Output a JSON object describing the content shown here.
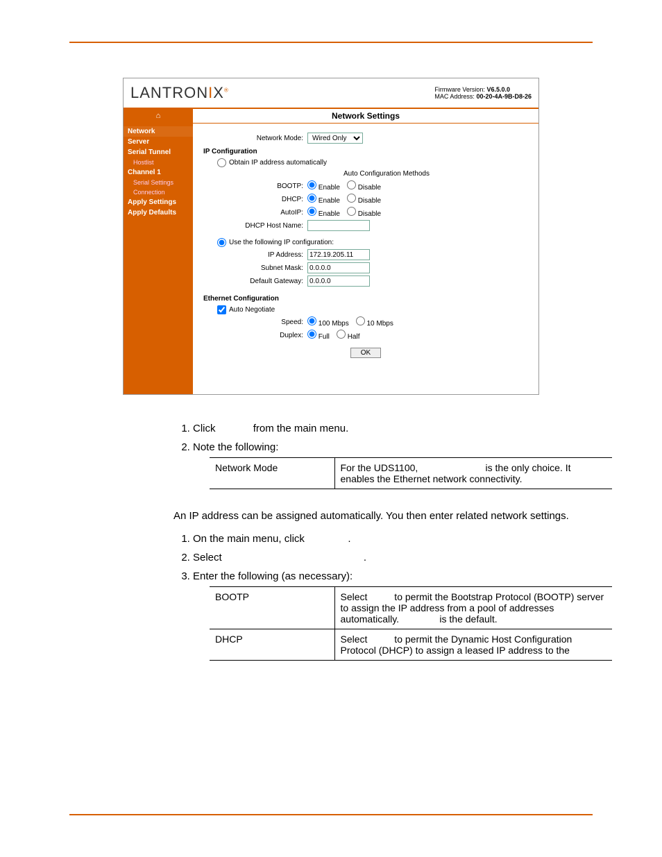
{
  "header_meta": {
    "fw_label": "Firmware Version:",
    "fw_value": "V6.5.0.0",
    "mac_label": "MAC Address:",
    "mac_value": "00-20-4A-9B-D8-26"
  },
  "logo": {
    "part1": "LANTRON",
    "part2": "I",
    "part3": "X",
    "reg": "®"
  },
  "page_title": "Network Settings",
  "sidebar": [
    {
      "label": "Network",
      "cls": "group current"
    },
    {
      "label": "Server",
      "cls": "group"
    },
    {
      "label": "Serial Tunnel",
      "cls": "group"
    },
    {
      "label": "Hostlist",
      "cls": "child"
    },
    {
      "label": "Channel 1",
      "cls": "group"
    },
    {
      "label": "Serial Settings",
      "cls": "child"
    },
    {
      "label": "Connection",
      "cls": "child"
    },
    {
      "label": "Apply Settings",
      "cls": "group"
    },
    {
      "label": "Apply Defaults",
      "cls": "group"
    }
  ],
  "form": {
    "network_mode_label": "Network Mode:",
    "network_mode_value": "Wired Only",
    "ip_config_h": "IP Configuration",
    "obtain_auto": "Obtain IP address automatically",
    "auto_methods": "Auto Configuration Methods",
    "bootp_label": "BOOTP:",
    "dhcp_label": "DHCP:",
    "autoip_label": "AutoIP:",
    "enable": "Enable",
    "disable": "Disable",
    "dhcp_host_label": "DHCP Host Name:",
    "use_following": "Use the following IP configuration:",
    "ip_addr_label": "IP Address:",
    "ip_addr_value": "172.19.205.11",
    "subnet_label": "Subnet Mask:",
    "subnet_value": "0.0.0.0",
    "gateway_label": "Default Gateway:",
    "gateway_value": "0.0.0.0",
    "eth_h": "Ethernet Configuration",
    "auto_negotiate": "Auto Negotiate",
    "speed_label": "Speed:",
    "speed_100": "100 Mbps",
    "speed_10": "10 Mbps",
    "duplex_label": "Duplex:",
    "full": "Full",
    "half": "Half",
    "ok": "OK"
  },
  "doc": {
    "step1": "Click",
    "step1_tail": "from the main menu.",
    "step2": "Note the following:",
    "t1c1": "Network Mode",
    "t1c2a": "For the UDS1100,",
    "t1c2b": "is the only choice. It enables the Ethernet network connectivity.",
    "para1": "An IP address can be assigned automatically. You then enter related network settings.",
    "s2_1a": "On the main menu, click",
    "s2_1b": ".",
    "s2_2a": "Select",
    "s2_2b": ".",
    "s2_3": "Enter the following (as necessary):",
    "t2r1c1": "BOOTP",
    "t2r1c2": "Select          to permit the Bootstrap Protocol (BOOTP) server to assign the IP address from a pool of addresses automatically.               is the default.",
    "t2r2c1": "DHCP",
    "t2r2c2": "Select          to permit the Dynamic Host Configuration Protocol (DHCP) to assign a leased IP address to the"
  }
}
